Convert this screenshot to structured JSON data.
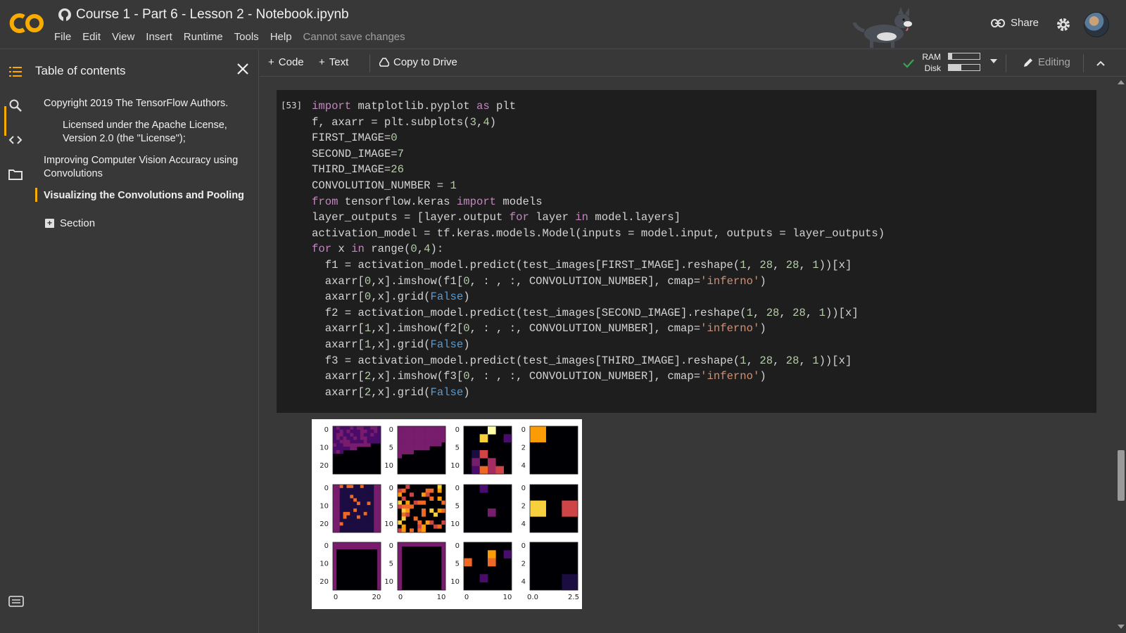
{
  "header": {
    "title": "Course 1 - Part 6 - Lesson 2 - Notebook.ipynb",
    "menu": [
      "File",
      "Edit",
      "View",
      "Insert",
      "Runtime",
      "Tools",
      "Help"
    ],
    "save_status": "Cannot save changes",
    "share_label": "Share"
  },
  "toc": {
    "heading": "Table of contents",
    "items": [
      "Copyright 2019 The TensorFlow Authors.",
      "Licensed under the Apache License, Version 2.0 (the \"License\");",
      "Improving Computer Vision Accuracy using Convolutions",
      "Visualizing the Convolutions and Pooling"
    ],
    "section_label": "Section"
  },
  "toolbar": {
    "code_label": "Code",
    "text_label": "Text",
    "copy_label": "Copy to Drive",
    "ram_label": "RAM",
    "disk_label": "Disk",
    "ram_fraction": 0.12,
    "disk_fraction": 0.42,
    "editing_label": "Editing"
  },
  "cell": {
    "exec_count": "[53]"
  },
  "output_plot": {
    "x_tick_labels": [
      [
        "0",
        "20"
      ],
      [
        "0",
        "10"
      ],
      [
        "0",
        "10"
      ],
      [
        "0.0",
        "2.5"
      ]
    ],
    "y_tick_labels": [
      [
        "0",
        "10",
        "20"
      ],
      [
        "0",
        "5",
        "10"
      ],
      [
        "0",
        "5",
        "10"
      ],
      [
        "0",
        "2",
        "4"
      ]
    ],
    "colormap": "inferno"
  },
  "colors": {
    "accent": "#f9ab00",
    "check_green": "#34a853",
    "keyword": "#c586c0",
    "builtin": "#569cd6",
    "number": "#b5cea8",
    "string": "#ce9178"
  }
}
